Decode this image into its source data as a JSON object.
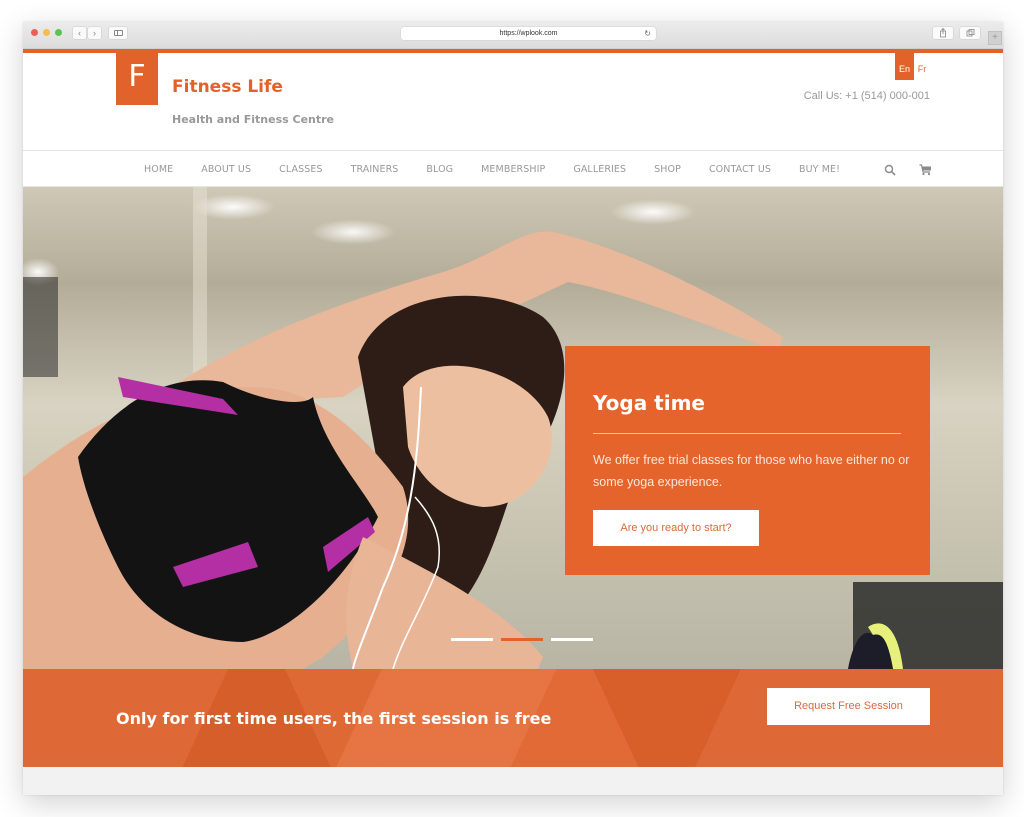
{
  "browser": {
    "url": "https://wplook.com",
    "back_label": "‹",
    "forward_label": "›",
    "new_tab_label": "+"
  },
  "header": {
    "logo_letter": "F",
    "site_title": "Fitness Life",
    "tagline": "Health and Fitness Centre",
    "languages": [
      {
        "code": "En",
        "active": true
      },
      {
        "code": "Fr",
        "active": false
      }
    ],
    "phone": "Call Us: +1 (514) 000-001"
  },
  "nav": {
    "items": [
      {
        "label": "HOME"
      },
      {
        "label": "ABOUT US"
      },
      {
        "label": "CLASSES"
      },
      {
        "label": "TRAINERS"
      },
      {
        "label": "BLOG"
      },
      {
        "label": "MEMBERSHIP"
      },
      {
        "label": "GALLERIES"
      },
      {
        "label": "SHOP"
      },
      {
        "label": "CONTACT US"
      },
      {
        "label": "BUY ME!"
      }
    ],
    "icons": [
      "search-icon",
      "cart-icon"
    ]
  },
  "hero": {
    "title": "Yoga time",
    "text": "We offer free trial classes for those who have either no or some yoga experience.",
    "button_label": "Are you ready to start?",
    "slides_total": 3,
    "active_slide": 2
  },
  "cta": {
    "text": "Only for first time users, the first session is free",
    "button_label": "Request Free Session"
  },
  "colors": {
    "accent": "#e2622c",
    "text_muted": "#999999",
    "white": "#ffffff"
  }
}
